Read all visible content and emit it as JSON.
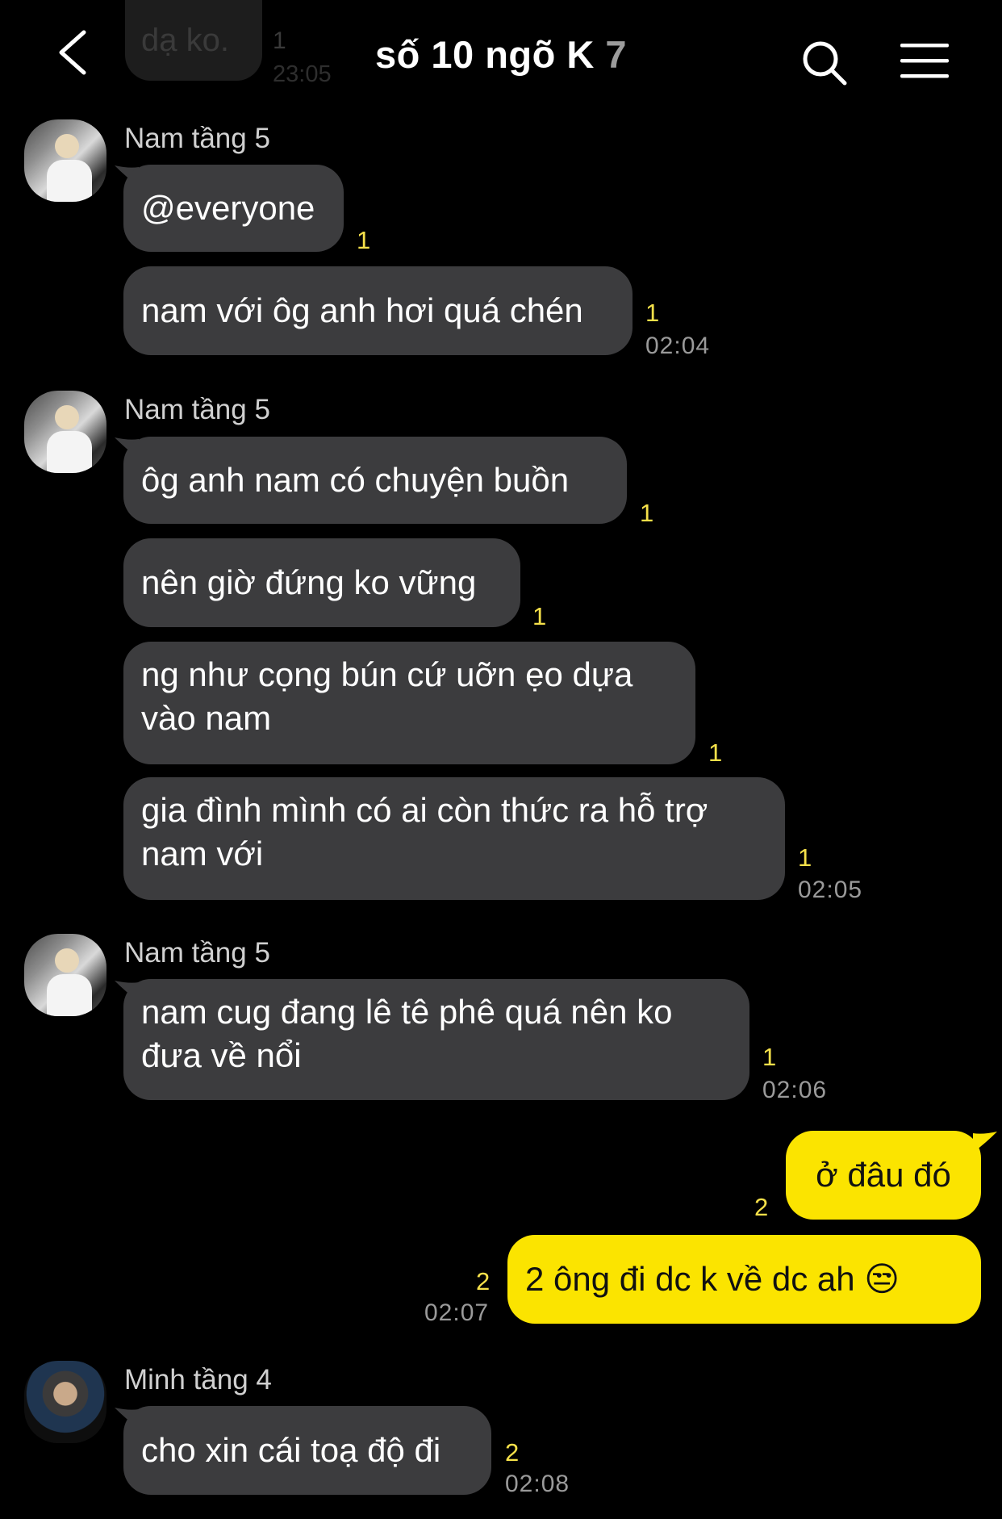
{
  "header": {
    "title": "số 10 ngõ K",
    "member_count": "7",
    "icons": {
      "back": "chevron-left-icon",
      "search": "search-icon",
      "menu": "hamburger-menu-icon"
    }
  },
  "ghost_message": {
    "text": "dạ ko.",
    "read": "1",
    "time": "23:05"
  },
  "messages": {
    "g1": {
      "sender": "Nam tầng 5",
      "m1": {
        "text": "@everyone",
        "read": "1"
      },
      "m2": {
        "text": "nam với ôg anh hơi quá chén",
        "read": "1",
        "time": "02:04"
      }
    },
    "g2": {
      "sender": "Nam tầng 5",
      "m1": {
        "text": "ôg anh nam có chuyện buồn",
        "read": "1"
      },
      "m2": {
        "text": "nên giờ đứng ko vững",
        "read": "1"
      },
      "m3": {
        "line1": "ng như cọng bún cứ uỡn ẹo dựa",
        "line2": "vào nam",
        "read": "1"
      },
      "m4": {
        "line1": "gia đình mình có ai còn thức ra hỗ trợ",
        "line2": "nam với",
        "read": "1",
        "time": "02:05"
      }
    },
    "g3": {
      "sender": "Nam tầng 5",
      "m1": {
        "line1": "nam cug đang lê tê phê quá nên ko",
        "line2": "đưa về nổi",
        "read": "1",
        "time": "02:06"
      }
    },
    "me": {
      "m1": {
        "text": "ở đâu đó",
        "read": "2"
      },
      "m2": {
        "text": "2 ông đi dc k về dc ah 😒",
        "read": "2",
        "time": "02:07"
      }
    },
    "g4": {
      "sender": "Minh tầng 4",
      "m1": {
        "text": "cho xin cái toạ độ đi",
        "read": "2",
        "time": "02:08"
      }
    }
  },
  "colors": {
    "background": "#000000",
    "bubble_other": "#3c3c3e",
    "bubble_me": "#fbe400",
    "read_count": "#f5e04a"
  }
}
